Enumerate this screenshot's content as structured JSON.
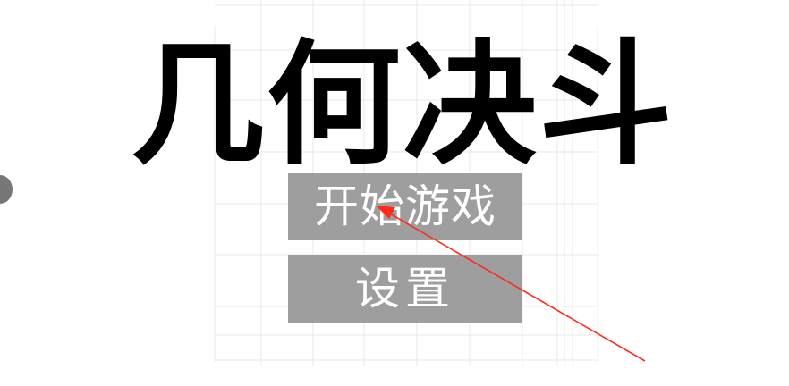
{
  "screen": "main-menu",
  "title": "几何决斗",
  "menu": {
    "start_label": "开始游戏",
    "settings_label": "设置"
  },
  "colors": {
    "background": "#ffffff",
    "title_text": "#000000",
    "button_fill": "#9e9e9e",
    "button_text": "#ffffff",
    "annotation_arrow": "#ff2a1a"
  },
  "icons": {
    "side_dot": "circle-icon",
    "annotation": "arrow-icon"
  }
}
